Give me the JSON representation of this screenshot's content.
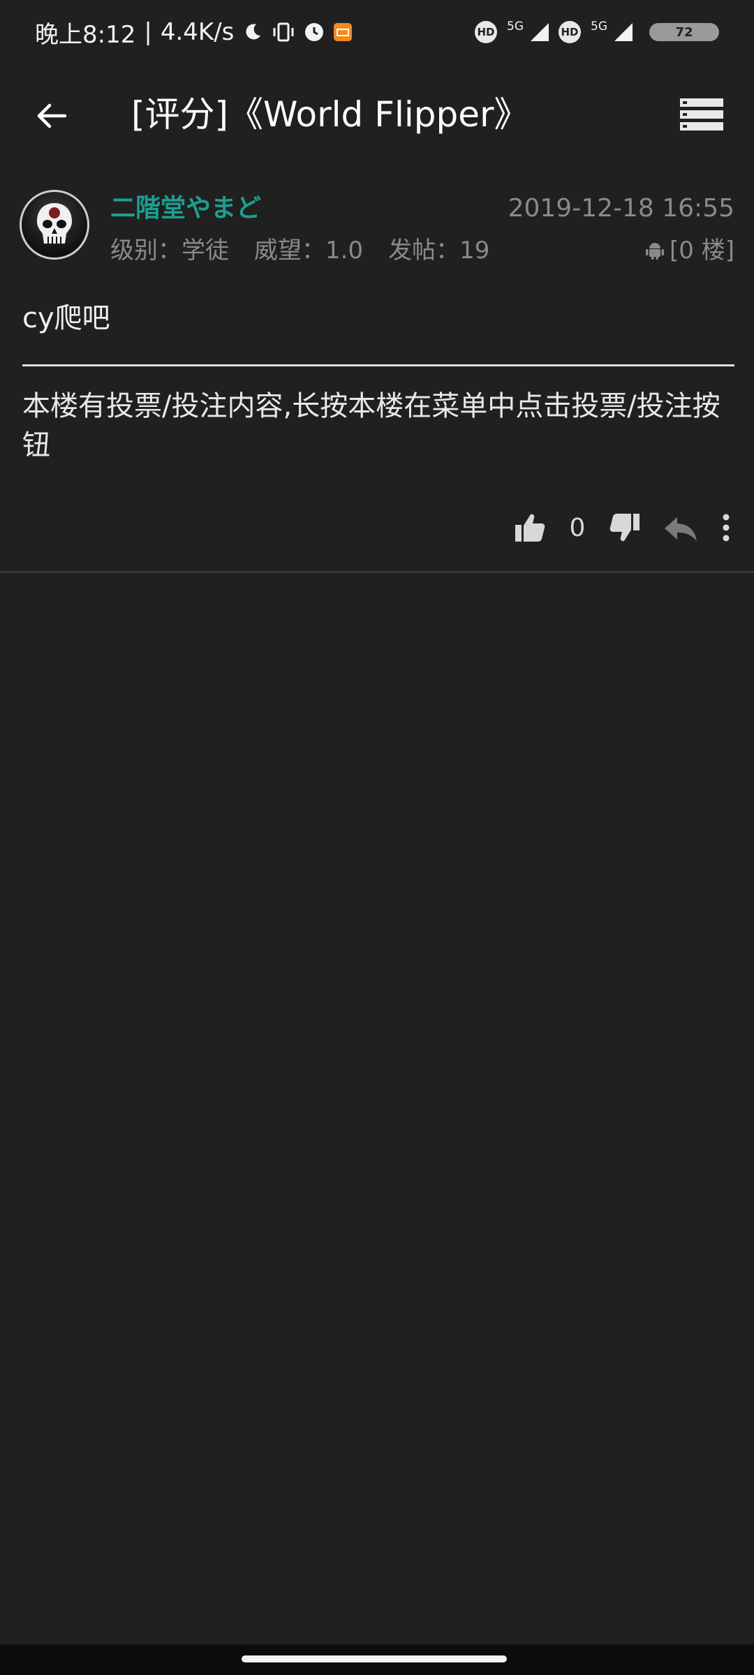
{
  "status_bar": {
    "time": "晚上8:12",
    "separator": "|",
    "speed": "4.4K/s",
    "network_1": "5G",
    "network_2": "5G",
    "hd_label": "HD",
    "battery": "72"
  },
  "toolbar": {
    "title": "[评分]《World Flipper》"
  },
  "post": {
    "username": "二階堂やまど",
    "timestamp": "2019-12-18 16:55",
    "level_label": "级别：学徒",
    "prestige_label": "威望：1.0",
    "posts_label": "发帖：19",
    "floor_label": "[0 楼]",
    "title": "cy爬吧",
    "body": "本楼有投票/投注内容,长按本楼在菜单中点击投票/投注按钮",
    "like_count": "0"
  },
  "colors": {
    "background": "#202020",
    "username": "#1e9e8f",
    "secondary_text": "#8a8a8a"
  }
}
